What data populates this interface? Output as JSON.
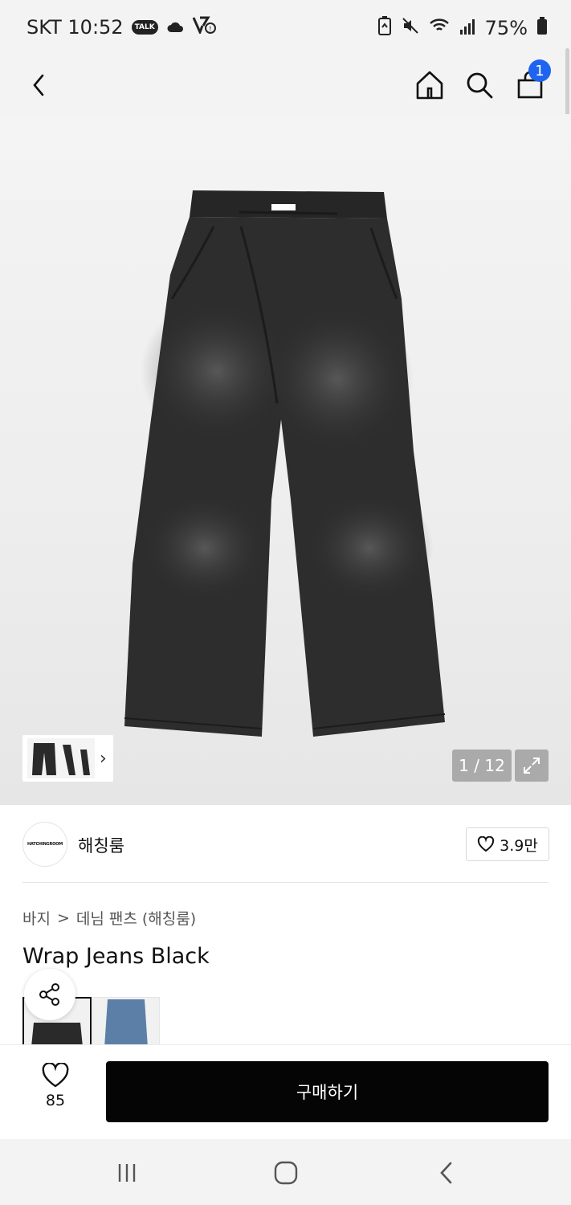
{
  "status_bar": {
    "carrier_time": "SKT 10:52",
    "talk_badge": "TALK",
    "battery": "75%"
  },
  "header": {
    "cart_count": "1",
    "icons": [
      "back-chevron-icon",
      "home-icon",
      "search-icon",
      "shopping-bag-icon"
    ]
  },
  "gallery": {
    "counter": "1 / 12",
    "thumbnail_arrow": "›",
    "brand_tag": "HATCHINGROOM"
  },
  "brand": {
    "logo_text": "HATCHINGROOM",
    "name": "해칭룸",
    "like_count": "3.9만"
  },
  "breadcrumb": {
    "category": "바지",
    "separator": ">",
    "subcategory": "데님 팬츠 (해칭룸)"
  },
  "product": {
    "title": "Wrap Jeans Black"
  },
  "swatches": [
    {
      "color": "#2a2a2a",
      "selected": true
    },
    {
      "color": "#5c7fa8",
      "selected": false
    }
  ],
  "bottom_bar": {
    "wish_count": "85",
    "buy_label": "구매하기"
  },
  "colors": {
    "accent_badge": "#1e64f0",
    "buy_button": "#050505"
  }
}
